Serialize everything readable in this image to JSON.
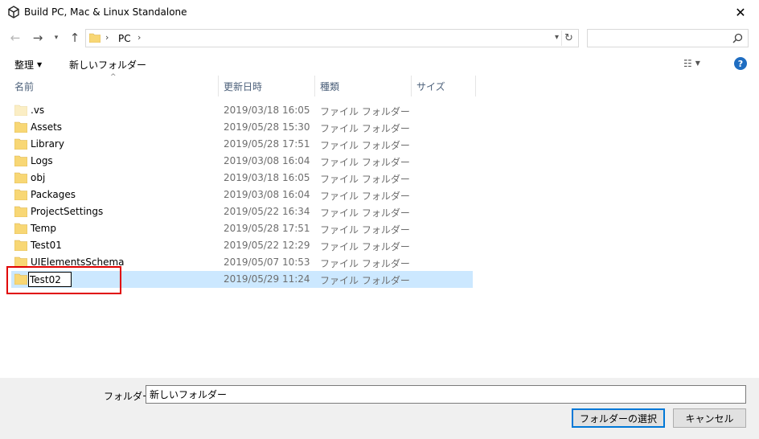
{
  "window": {
    "title": "Build PC, Mac & Linux Standalone"
  },
  "address": {
    "crumb": "PC",
    "search_placeholder": ""
  },
  "toolbar": {
    "organize_label": "整理",
    "new_folder_label": "新しいフォルダー"
  },
  "columns": {
    "name": "名前",
    "date": "更新日時",
    "type": "種類",
    "size": "サイズ"
  },
  "files": [
    {
      "name": ".vs",
      "date": "2019/03/18 16:05",
      "type": "ファイル フォルダー"
    },
    {
      "name": "Assets",
      "date": "2019/05/28 15:30",
      "type": "ファイル フォルダー"
    },
    {
      "name": "Library",
      "date": "2019/05/28 17:51",
      "type": "ファイル フォルダー"
    },
    {
      "name": "Logs",
      "date": "2019/03/08 16:04",
      "type": "ファイル フォルダー"
    },
    {
      "name": "obj",
      "date": "2019/03/18 16:05",
      "type": "ファイル フォルダー"
    },
    {
      "name": "Packages",
      "date": "2019/03/08 16:04",
      "type": "ファイル フォルダー"
    },
    {
      "name": "ProjectSettings",
      "date": "2019/05/22 16:34",
      "type": "ファイル フォルダー"
    },
    {
      "name": "Temp",
      "date": "2019/05/28 17:51",
      "type": "ファイル フォルダー"
    },
    {
      "name": "Test01",
      "date": "2019/05/22 12:29",
      "type": "ファイル フォルダー"
    },
    {
      "name": "UIElementsSchema",
      "date": "2019/05/07 10:53",
      "type": "ファイル フォルダー"
    }
  ],
  "renaming": {
    "value": "Test02",
    "date": "2019/05/29 11:24",
    "type": "ファイル フォルダー"
  },
  "footer": {
    "folder_label": "フォルダー:",
    "folder_value": "新しいフォルダー",
    "select_button": "フォルダーの選択",
    "cancel_button": "キャンセル"
  },
  "colors": {
    "selection": "#cce8ff",
    "highlight": "#e00000",
    "accent": "#0078d7",
    "folder": "#f8d775"
  }
}
